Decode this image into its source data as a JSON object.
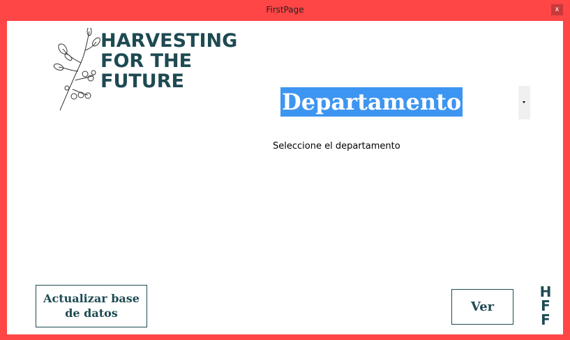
{
  "window": {
    "title": "FirstPage",
    "close_label": "x"
  },
  "logo": {
    "line1": "HARVESTING",
    "line2": "FOR THE",
    "line3": "FUTURE"
  },
  "department_select": {
    "selected_value": "Departamento",
    "hint": "Seleccione el departamento"
  },
  "buttons": {
    "update_database": "Actualizar base de datos",
    "view": "Ver"
  },
  "corner_mark": {
    "letters": [
      "H",
      "F",
      "F"
    ]
  },
  "colors": {
    "window_border": "#ff4646",
    "brand": "#1e4a52",
    "selection": "#3d95f2"
  }
}
